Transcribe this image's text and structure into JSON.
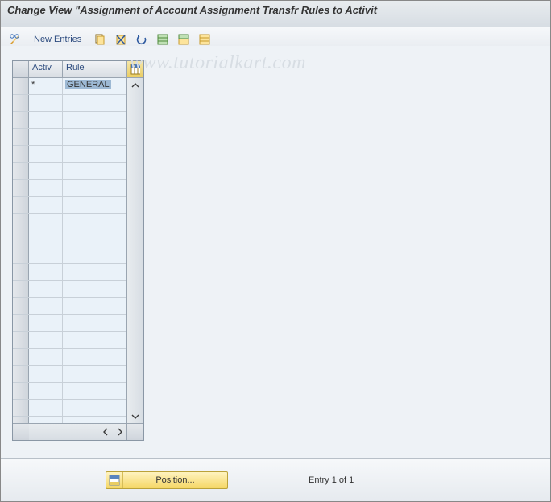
{
  "title": "Change View \"Assignment of Account Assignment Transfr Rules to Activit",
  "watermark": "www.tutorialkart.com",
  "toolbar": {
    "new_entries": "New Entries"
  },
  "grid": {
    "columns": {
      "activ": "Activ",
      "rule": "Rule"
    },
    "rows": [
      {
        "activ": "*",
        "rule": "GENERAL"
      }
    ],
    "empty_row_count": 20
  },
  "footer": {
    "position_label": "Position...",
    "entry_text": "Entry 1 of 1"
  }
}
